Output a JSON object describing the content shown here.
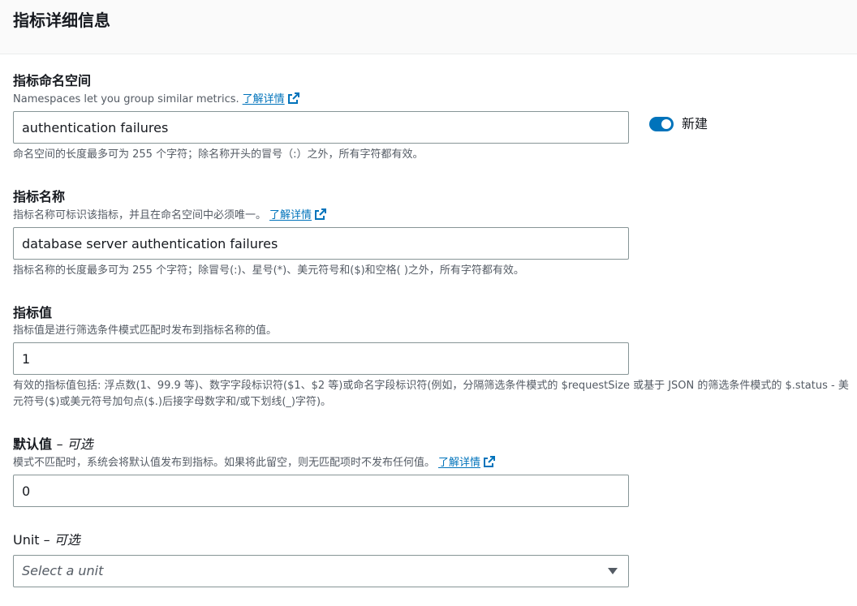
{
  "header": {
    "title": "指标详细信息"
  },
  "namespace": {
    "label": "指标命名空间",
    "description": "Namespaces let you group similar metrics.",
    "learn_more": "了解详情",
    "value": "authentication failures",
    "constraint": "命名空间的长度最多可为 255 个字符；除名称开头的冒号（:）之外，所有字符都有效。",
    "toggle_label": "新建"
  },
  "metric_name": {
    "label": "指标名称",
    "description": "指标名称可标识该指标，并且在命名空间中必须唯一。",
    "learn_more": "了解详情",
    "value": "database server authentication failures",
    "constraint": "指标名称的长度最多可为 255 个字符；除冒号(:)、星号(*)、美元符号和($)和空格( )之外，所有字符都有效。"
  },
  "metric_value": {
    "label": "指标值",
    "description": "指标值是进行筛选条件模式匹配时发布到指标名称的值。",
    "value": "1",
    "constraint": "有效的指标值包括: 浮点数(1、99.9 等)、数字字段标识符($1、$2 等)或命名字段标识符(例如，分隔筛选条件模式的 $requestSize 或基于 JSON 的筛选条件模式的 $.status - 美元符号($)或美元符号加句点($.)后接字母数字和/或下划线(_)字符)。"
  },
  "default_value": {
    "label": "默认值",
    "optional": "– 可选",
    "description": "模式不匹配时，系统会将默认值发布到指标。如果将此留空，则无匹配项时不发布任何值。",
    "learn_more": "了解详情",
    "value": "0"
  },
  "unit": {
    "label": "Unit",
    "optional": "– 可选",
    "placeholder": "Select a unit"
  },
  "colors": {
    "accent": "#0073bb",
    "border": "#879596",
    "muted_text": "#545b64"
  }
}
